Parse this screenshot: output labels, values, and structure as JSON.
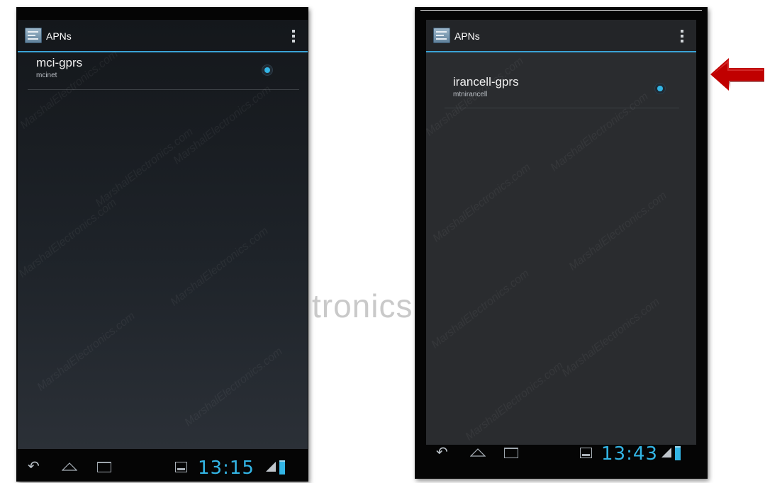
{
  "background_watermark": "tronics.c",
  "screenshots": [
    {
      "app_title": "APNs",
      "apn_name": "mci-gprs",
      "apn_value": "mcinet",
      "selected": true,
      "clock": "13:15",
      "overlay_watermark": "MarshalElectronics.com"
    },
    {
      "app_title": "APNs",
      "apn_name": "irancell-gprs",
      "apn_value": "mtnirancell",
      "selected": true,
      "clock": "13:43",
      "overlay_watermark": "MarshalElectronics.com"
    }
  ],
  "icons": {
    "app": "settings-apn-icon",
    "overflow": "overflow-menu-icon",
    "back": "back-icon",
    "home": "home-icon",
    "recent": "recent-apps-icon",
    "gallery": "gallery-icon",
    "signal": "signal-icon",
    "battery": "battery-icon",
    "arrow": "red-left-arrow-icon"
  },
  "colors": {
    "accent": "#33b5e5",
    "arrow": "#c00000"
  }
}
